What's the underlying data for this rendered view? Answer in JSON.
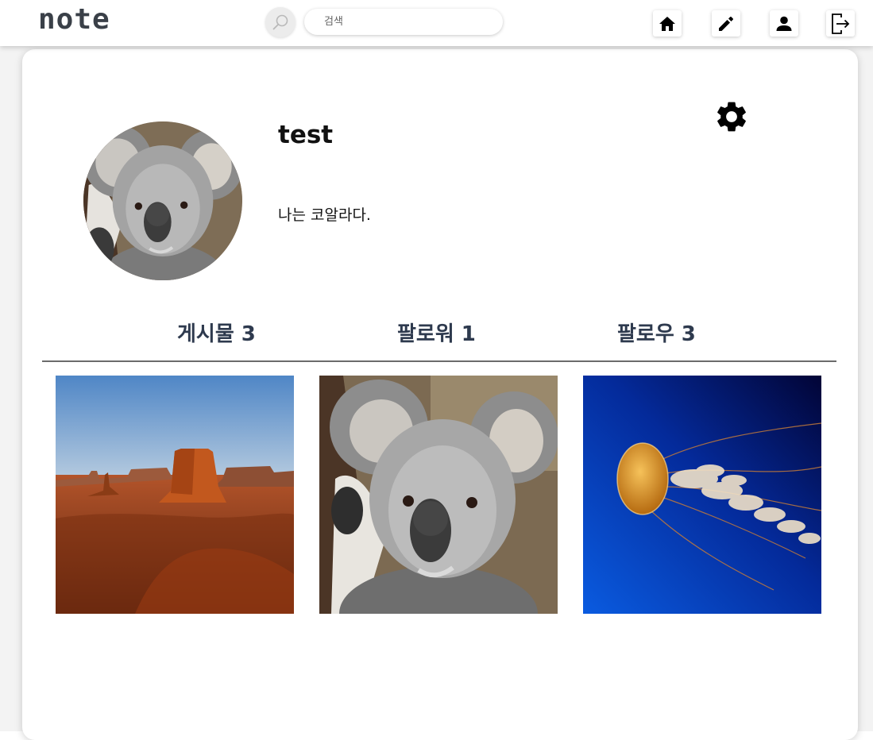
{
  "app": {
    "logo": "note"
  },
  "search": {
    "placeholder": "검색"
  },
  "nav": {
    "home_icon": "home-icon",
    "write_icon": "pencil-icon",
    "profile_icon": "person-icon",
    "logout_icon": "logout-icon"
  },
  "profile": {
    "username": "test",
    "bio": "나는 코알라다.",
    "avatar": "koala-photo",
    "settings_icon": "gear-icon"
  },
  "stats": {
    "posts_label": "게시물",
    "posts_count": "3",
    "followers_label": "팔로워",
    "followers_count": "1",
    "following_label": "팔로우",
    "following_count": "3"
  },
  "posts": [
    {
      "image": "desert-butte-photo"
    },
    {
      "image": "koala-photo"
    },
    {
      "image": "jellyfish-photo"
    }
  ],
  "colors": {
    "stat_text": "#2e3a4e",
    "divider": "#6b6b6b",
    "logo": "#3a4048"
  }
}
